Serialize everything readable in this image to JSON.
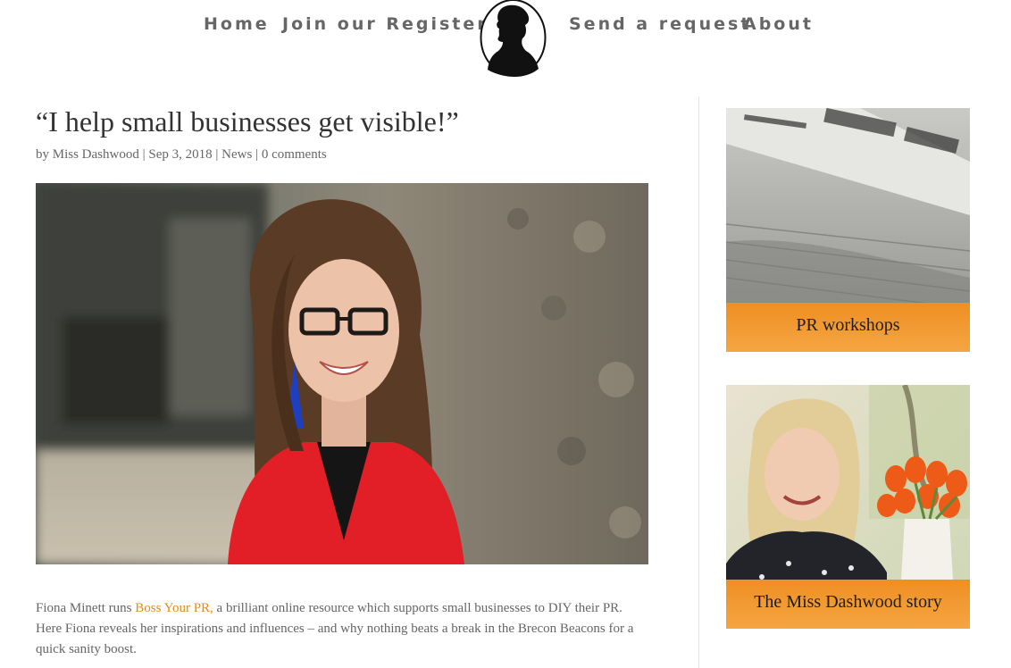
{
  "nav": {
    "home": "Home",
    "join": "Join our Register",
    "send": "Send a request",
    "about": "About"
  },
  "post": {
    "title": "“I help small businesses get visible!”",
    "meta": {
      "by": "by",
      "author": "Miss Dashwood",
      "sep1": "|",
      "date": "Sep 3, 2018",
      "sep2": "|",
      "category": "News",
      "sep3": "|",
      "comments": "0 comments"
    },
    "body": {
      "intro": "Fiona Minett runs ",
      "link": "Boss Your PR,",
      "rest": " a brilliant online resource which supports small businesses to DIY their PR. Here Fiona reveals her inspirations and influences – and why nothing beats a break in the Brecon Beacons for a quick sanity boost."
    }
  },
  "sidebar": {
    "card1_caption": "PR workshops",
    "card2_caption": "The Miss Dashwood story"
  },
  "colors": {
    "accent": "#e8891b",
    "caption_band": "#f19b31",
    "text": "#666666",
    "heading": "#333333"
  }
}
